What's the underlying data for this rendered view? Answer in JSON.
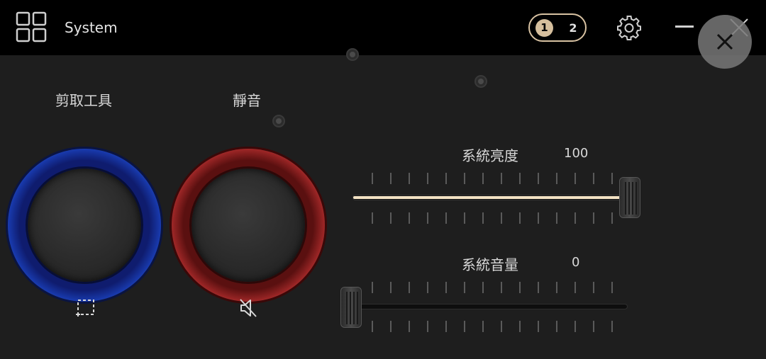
{
  "header": {
    "title": "System",
    "pages": [
      "1",
      "2"
    ],
    "active_page": "1"
  },
  "icons": {
    "apps": "grid-icon",
    "settings": "gear-icon",
    "minimize": "minimize-icon",
    "close": "close-icon",
    "close_overlay": "close-icon",
    "snip": "snip-icon",
    "mute": "mute-icon"
  },
  "knobs": [
    {
      "label": "剪取工具",
      "color": "#2a52d0",
      "icon": "snip-icon"
    },
    {
      "label": "靜音",
      "color": "#b83030",
      "icon": "mute-icon"
    }
  ],
  "sliders": [
    {
      "label": "系統亮度",
      "value": "100",
      "level": 1.0
    },
    {
      "label": "系統音量",
      "value": "0",
      "level": 0.0
    }
  ],
  "colors": {
    "accent": "#d6bf9d",
    "slider_fill": "#f3e2c4",
    "background": "#1e1e1e",
    "topbar": "#000000"
  }
}
